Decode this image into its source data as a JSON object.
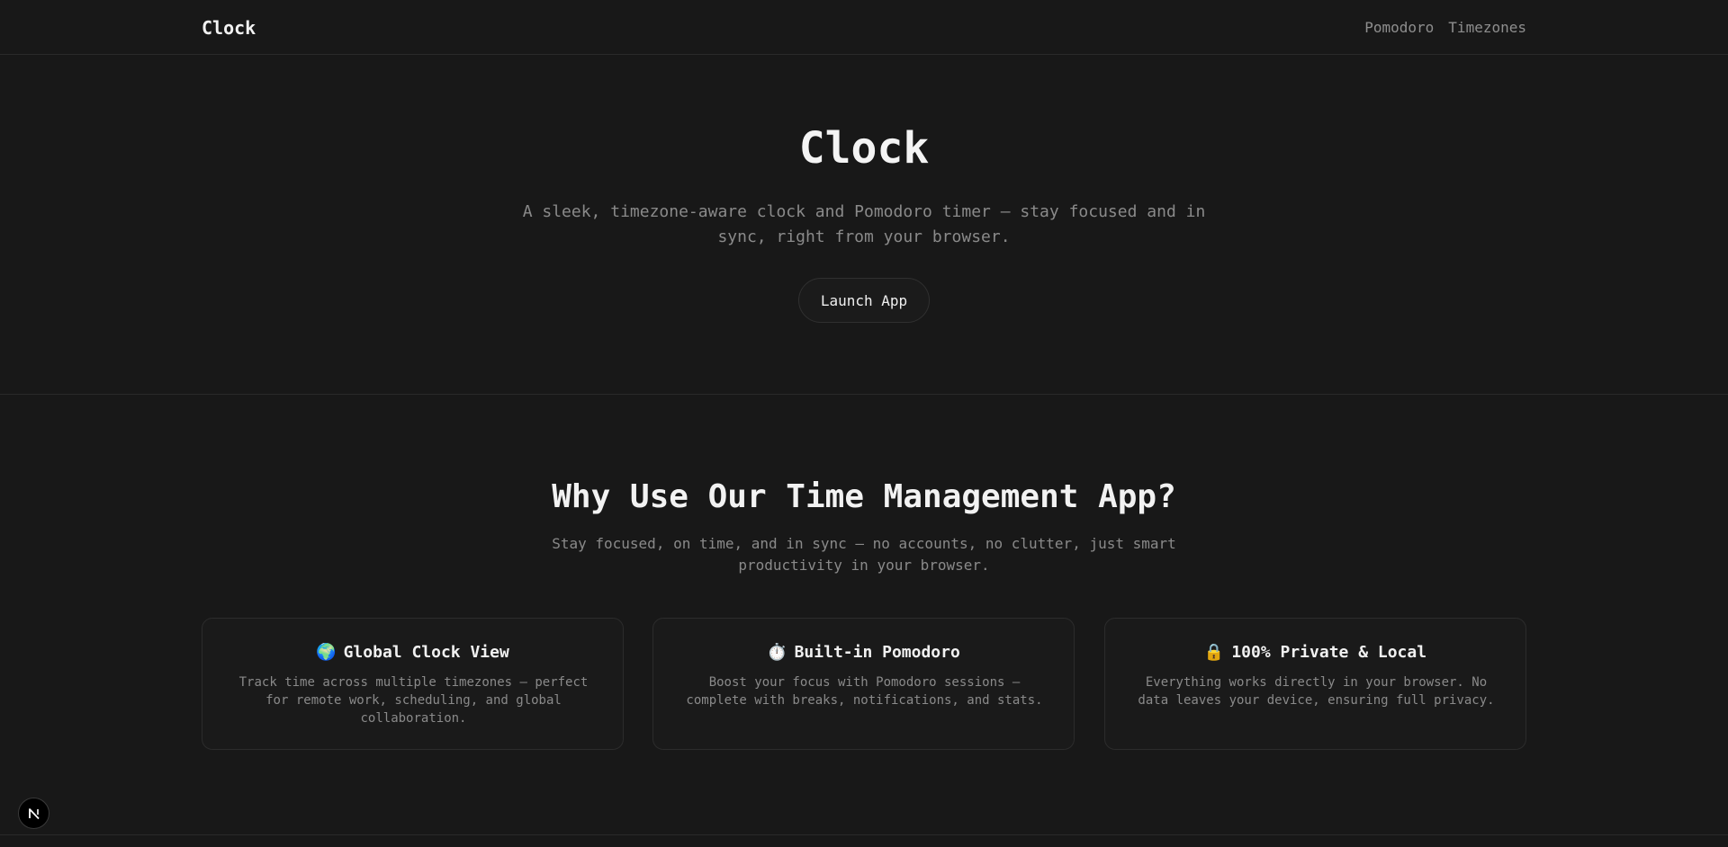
{
  "header": {
    "brand": "Clock",
    "nav": [
      {
        "label": "Pomodoro"
      },
      {
        "label": "Timezones"
      }
    ]
  },
  "hero": {
    "title": "Clock",
    "subtitle": "A sleek, timezone-aware clock and Pomodoro timer — stay focused and in sync, right from your browser.",
    "cta": "Launch App"
  },
  "features": {
    "title": "Why Use Our Time Management App?",
    "subtitle": "Stay focused, on time, and in sync — no accounts, no clutter, just smart productivity in your browser.",
    "cards": [
      {
        "icon": "🌍",
        "icon_name": "globe-icon",
        "title": "Global Clock View",
        "description": "Track time across multiple timezones — perfect for remote work, scheduling, and global collaboration."
      },
      {
        "icon": "⏱️",
        "icon_name": "stopwatch-icon",
        "title": "Built-in Pomodoro",
        "description": "Boost your focus with Pomodoro sessions — complete with breaks, notifications, and stats."
      },
      {
        "icon": "🔒",
        "icon_name": "lock-icon",
        "title": "100% Private & Local",
        "description": "Everything works directly in your browser. No data leaves your device, ensuring full privacy."
      }
    ]
  },
  "devtools_badge": {
    "letter": "N",
    "icon_name": "nextjs-icon"
  },
  "colors": {
    "background": "#181818",
    "border": "#2a2a2a",
    "text_primary": "#f2f2f2",
    "text_muted": "#8a8a8a"
  }
}
